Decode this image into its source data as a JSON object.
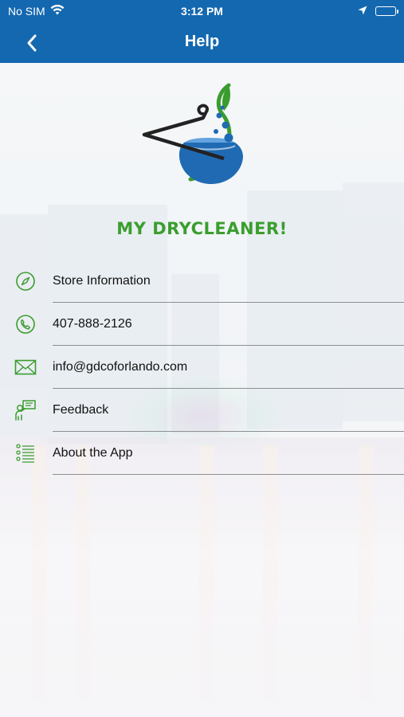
{
  "status_bar": {
    "carrier": "No SIM",
    "time": "3:12 PM",
    "wifi_icon": "wifi-icon",
    "location_icon": "location-arrow-icon",
    "battery_icon": "battery-icon"
  },
  "nav": {
    "title": "Help",
    "back_icon": "chevron-left-icon"
  },
  "brand": {
    "name": "MY DRYCLEANER!",
    "logo_icon": "hanger-flask-leaf-logo"
  },
  "menu": {
    "items": [
      {
        "label": "Store Information",
        "icon": "compass-icon"
      },
      {
        "label": "407-888-2126",
        "icon": "phone-icon"
      },
      {
        "label": "info@gdcoforlando.com",
        "icon": "envelope-icon"
      },
      {
        "label": "Feedback",
        "icon": "feedback-person-icon"
      },
      {
        "label": "About the App",
        "icon": "list-icon"
      }
    ]
  },
  "colors": {
    "nav_bar": "#1468b0",
    "brand_green": "#3b9e2f",
    "icon_green": "#3a9c2e",
    "logo_blue": "#1f6ab3"
  }
}
